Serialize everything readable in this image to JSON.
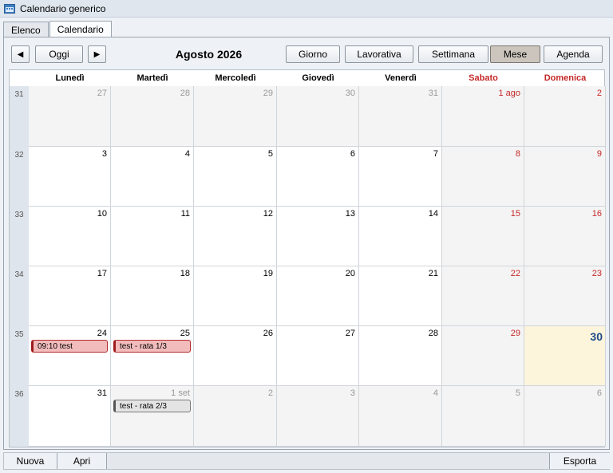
{
  "window": {
    "title": "Calendario generico"
  },
  "tabs": [
    {
      "label": "Elenco"
    },
    {
      "label": "Calendario"
    }
  ],
  "toolbar": {
    "prev": "◀",
    "today": "Oggi",
    "next": "▶",
    "month_title": "Agosto 2026",
    "views": [
      {
        "label": "Giorno"
      },
      {
        "label": "Lavorativa"
      },
      {
        "label": "Settimana"
      },
      {
        "label": "Mese"
      },
      {
        "label": "Agenda"
      }
    ]
  },
  "weekdays": [
    "Lunedì",
    "Martedì",
    "Mercoledì",
    "Giovedì",
    "Venerdì",
    "Sabato",
    "Domenica"
  ],
  "weeks": [
    {
      "num": "31",
      "days": [
        {
          "label": "27",
          "other": true
        },
        {
          "label": "28",
          "other": true
        },
        {
          "label": "29",
          "other": true
        },
        {
          "label": "30",
          "other": true
        },
        {
          "label": "31",
          "other": true
        },
        {
          "label": "1 ago",
          "weekend": true
        },
        {
          "label": "2",
          "weekend": true
        }
      ]
    },
    {
      "num": "32",
      "days": [
        {
          "label": "3"
        },
        {
          "label": "4"
        },
        {
          "label": "5"
        },
        {
          "label": "6"
        },
        {
          "label": "7"
        },
        {
          "label": "8",
          "weekend": true
        },
        {
          "label": "9",
          "weekend": true
        }
      ]
    },
    {
      "num": "33",
      "days": [
        {
          "label": "10"
        },
        {
          "label": "11"
        },
        {
          "label": "12"
        },
        {
          "label": "13"
        },
        {
          "label": "14"
        },
        {
          "label": "15",
          "weekend": true
        },
        {
          "label": "16",
          "weekend": true
        }
      ]
    },
    {
      "num": "34",
      "days": [
        {
          "label": "17"
        },
        {
          "label": "18"
        },
        {
          "label": "19"
        },
        {
          "label": "20"
        },
        {
          "label": "21"
        },
        {
          "label": "22",
          "weekend": true
        },
        {
          "label": "23",
          "weekend": true
        }
      ]
    },
    {
      "num": "35",
      "days": [
        {
          "label": "24",
          "events": [
            {
              "text": "09:10  test",
              "color": "red"
            }
          ]
        },
        {
          "label": "25",
          "events": [
            {
              "text": "test - rata 1/3",
              "color": "red"
            }
          ]
        },
        {
          "label": "26"
        },
        {
          "label": "27"
        },
        {
          "label": "28"
        },
        {
          "label": "29",
          "weekend": true
        },
        {
          "label": "30",
          "today": true
        }
      ]
    },
    {
      "num": "36",
      "days": [
        {
          "label": "31"
        },
        {
          "label": "1 set",
          "other": true,
          "events": [
            {
              "text": "test - rata 2/3",
              "color": "gray"
            }
          ]
        },
        {
          "label": "2",
          "other": true
        },
        {
          "label": "3",
          "other": true
        },
        {
          "label": "4",
          "other": true
        },
        {
          "label": "5",
          "other": true
        },
        {
          "label": "6",
          "other": true
        }
      ]
    }
  ],
  "footer": {
    "new": "Nuova",
    "open": "Apri",
    "export": "Esporta"
  },
  "colors": {
    "weekend": "#c62828",
    "today_bg": "#fcf5dc",
    "event_red": "#f2bcbc",
    "selected_view": "#cbc5bd"
  }
}
